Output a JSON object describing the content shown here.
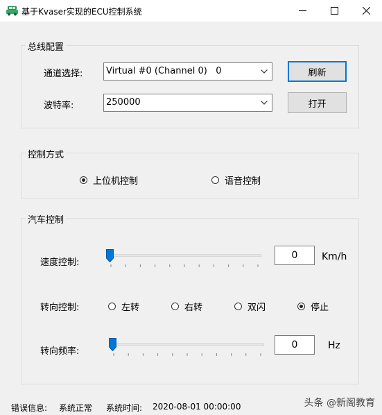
{
  "window": {
    "title": "基于Kvaser实现的ECU控制系统"
  },
  "bus_config": {
    "group_label": "总线配置",
    "channel_label": "通道选择:",
    "channel_value": "Virtual #0 (Channel 0)   0",
    "baud_label": "波特率:",
    "baud_value": "250000",
    "refresh_button": "刷新",
    "open_button": "打开"
  },
  "control_mode": {
    "group_label": "控制方式",
    "options": [
      {
        "label": "上位机控制",
        "checked": true
      },
      {
        "label": "语音控制",
        "checked": false
      }
    ]
  },
  "car_control": {
    "group_label": "汽车控制",
    "speed_label": "速度控制:",
    "speed_value": "0",
    "speed_unit": "Km/h",
    "speed_level": 0,
    "turn_label": "转向控制:",
    "turn_options": [
      {
        "label": "左转",
        "checked": false
      },
      {
        "label": "右转",
        "checked": false
      },
      {
        "label": "双闪",
        "checked": false
      },
      {
        "label": "停止",
        "checked": true
      }
    ],
    "freq_label": "转向频率:",
    "freq_value": "0",
    "freq_unit": "Hz",
    "freq_level": 0
  },
  "status_bar": {
    "error_label": "错误信息:",
    "error_value": "系统正常",
    "time_label": "系统时间:",
    "time_value": "2020-08-01 00:00:00"
  },
  "watermark": "头条 @新阁教育"
}
